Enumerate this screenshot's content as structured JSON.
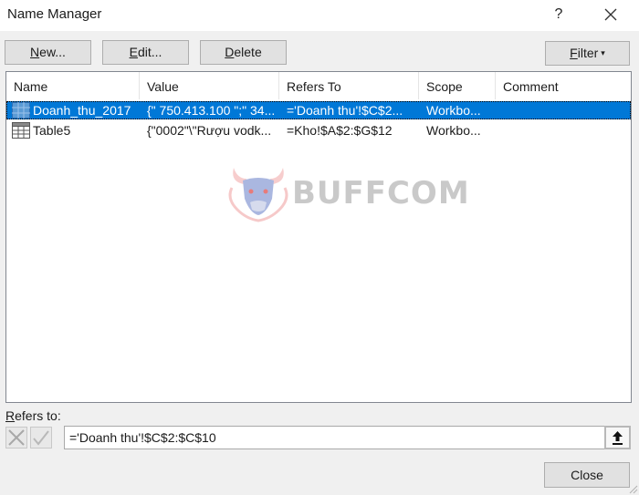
{
  "window": {
    "title": "Name Manager",
    "help_label": "?",
    "close_icon": "close-x-icon"
  },
  "toolbar": {
    "new_prefix": "",
    "new_mnemonic": "N",
    "new_rest": "ew...",
    "edit_mnemonic": "E",
    "edit_rest": "dit...",
    "delete_mnemonic": "D",
    "delete_rest": "elete",
    "filter_mnemonic": "F",
    "filter_rest": "ilter",
    "filter_caret": "▾"
  },
  "table": {
    "columns": [
      "Name",
      "Value",
      "Refers To",
      "Scope",
      "Comment"
    ],
    "rows": [
      {
        "icon": "table-range-icon",
        "name": "Doanh_thu_2017",
        "value": "{\" 750.413.100 \";\" 34...",
        "refers_to": "='Doanh thu'!$C$2...",
        "scope": "Workbo...",
        "comment": "",
        "selected": true
      },
      {
        "icon": "table-icon",
        "name": "Table5",
        "value": "{\"0002\"\\\"Rượu vodk...",
        "refers_to": "=Kho!$A$2:$G$12",
        "scope": "Workbo...",
        "comment": "",
        "selected": false
      }
    ]
  },
  "watermark": {
    "text": "BUFFCOM"
  },
  "refers_to": {
    "label_mnemonic": "R",
    "label_rest": "efers to:",
    "value": "='Doanh thu'!$C$2:$C$10"
  },
  "footer": {
    "close_label": "Close"
  },
  "colors": {
    "selection": "#0078d7",
    "dialog_bg": "#f0f0f0",
    "button_bg": "#e1e1e1"
  }
}
